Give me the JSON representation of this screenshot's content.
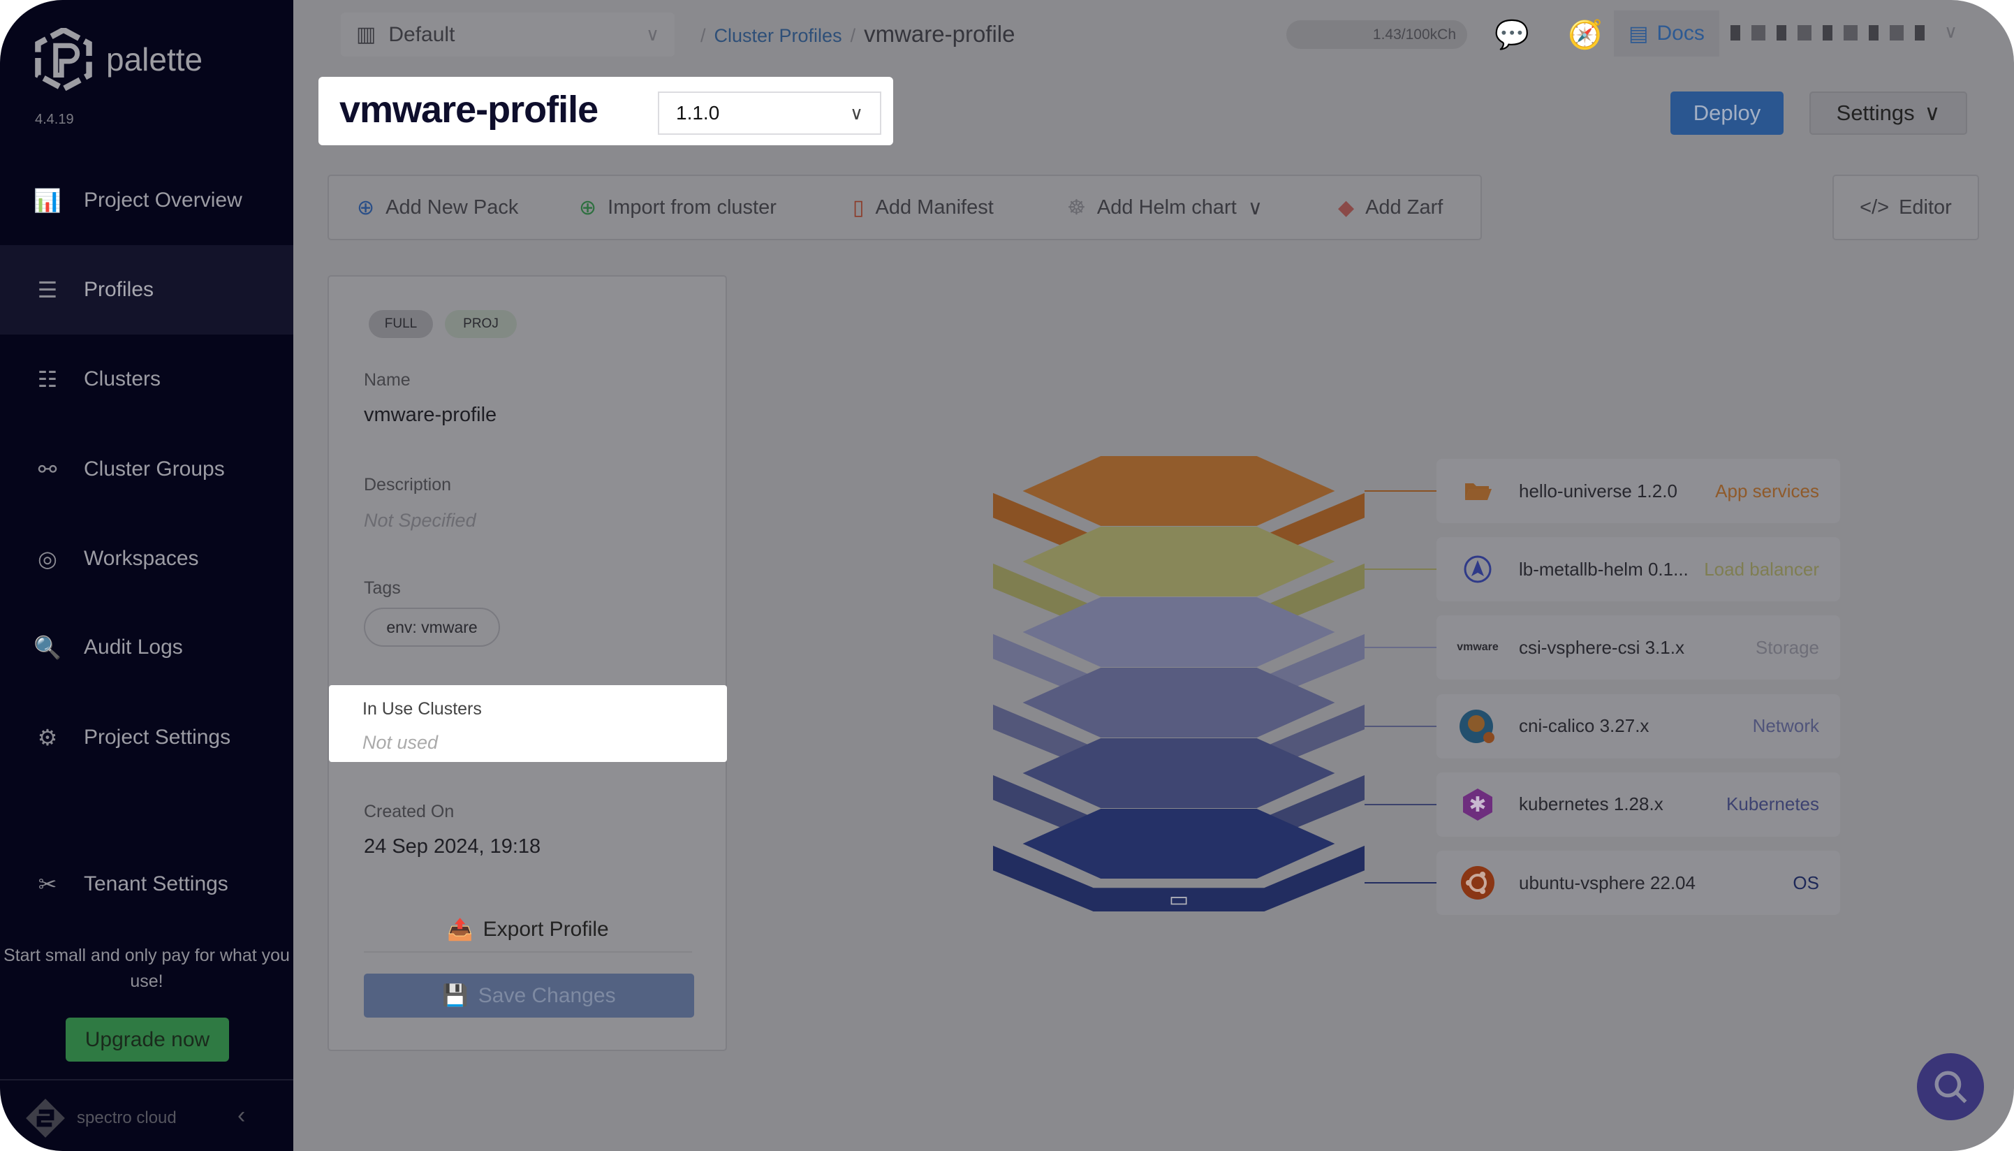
{
  "sidebar": {
    "brand": "palette",
    "version": "4.4.19",
    "items": [
      {
        "label": "Project Overview",
        "icon": "chart-icon"
      },
      {
        "label": "Profiles",
        "icon": "stack-icon",
        "active": true
      },
      {
        "label": "Clusters",
        "icon": "clusters-icon"
      },
      {
        "label": "Cluster Groups",
        "icon": "cluster-groups-icon"
      },
      {
        "label": "Workspaces",
        "icon": "workspaces-icon"
      },
      {
        "label": "Audit Logs",
        "icon": "audit-icon"
      },
      {
        "label": "Project Settings",
        "icon": "gear-icon"
      },
      {
        "label": "Tenant Settings",
        "icon": "tools-icon"
      }
    ],
    "promo": "Start small and only pay for what you use!",
    "upgrade": "Upgrade now",
    "footer_brand": "spectro cloud"
  },
  "topbar": {
    "project": "Default",
    "breadcrumb": {
      "parent": "Cluster Profiles",
      "current": "vmware-profile"
    },
    "credits": "1.43/100kCh",
    "docs": "Docs"
  },
  "header": {
    "title": "vmware-profile",
    "version": "1.1.0",
    "deploy": "Deploy",
    "settings": "Settings"
  },
  "toolbar": {
    "items": [
      "Add New Pack",
      "Import from cluster",
      "Add Manifest",
      "Add Helm chart",
      "Add Zarf"
    ],
    "editor": "Editor"
  },
  "details": {
    "badges": [
      "FULL",
      "PROJ"
    ],
    "name_label": "Name",
    "name": "vmware-profile",
    "description_label": "Description",
    "description": "Not Specified",
    "tags_label": "Tags",
    "tags": [
      "env: vmware"
    ],
    "in_use_label": "In Use Clusters",
    "in_use": "Not used",
    "created_label": "Created On",
    "created": "24 Sep 2024, 19:18",
    "export": "Export Profile",
    "save": "Save Changes"
  },
  "packs": [
    {
      "name": "hello-universe 1.2.0",
      "type": "App services",
      "type_color": "#8f5a2a",
      "layer_face": "#925c2c",
      "layer_side": "#8a5224",
      "icon": "folder-icon"
    },
    {
      "name": "lb-metallb-helm 0.1...",
      "type": "Load balancer",
      "type_color": "#7f7e52",
      "layer_face": "#888759",
      "layer_side": "#7f7e50",
      "icon": "metallb-icon"
    },
    {
      "name": "csi-vsphere-csi 3.1.x",
      "type": "Storage",
      "type_color": "#6e6e78",
      "layer_face": "#6f7290",
      "layer_side": "#696c8a",
      "icon": "vmware-icon"
    },
    {
      "name": "cni-calico 3.27.x",
      "type": "Network",
      "type_color": "#50547a",
      "layer_face": "#585c80",
      "layer_side": "#53577a",
      "icon": "calico-icon"
    },
    {
      "name": "kubernetes 1.28.x",
      "type": "Kubernetes",
      "type_color": "#3d4270",
      "layer_face": "#3f4672",
      "layer_side": "#3b426c",
      "icon": "kubernetes-icon"
    },
    {
      "name": "ubuntu-vsphere 22.04",
      "type": "OS",
      "type_color": "#1e2858",
      "layer_face": "#253167",
      "layer_side": "#222d60",
      "icon": "ubuntu-icon"
    }
  ]
}
